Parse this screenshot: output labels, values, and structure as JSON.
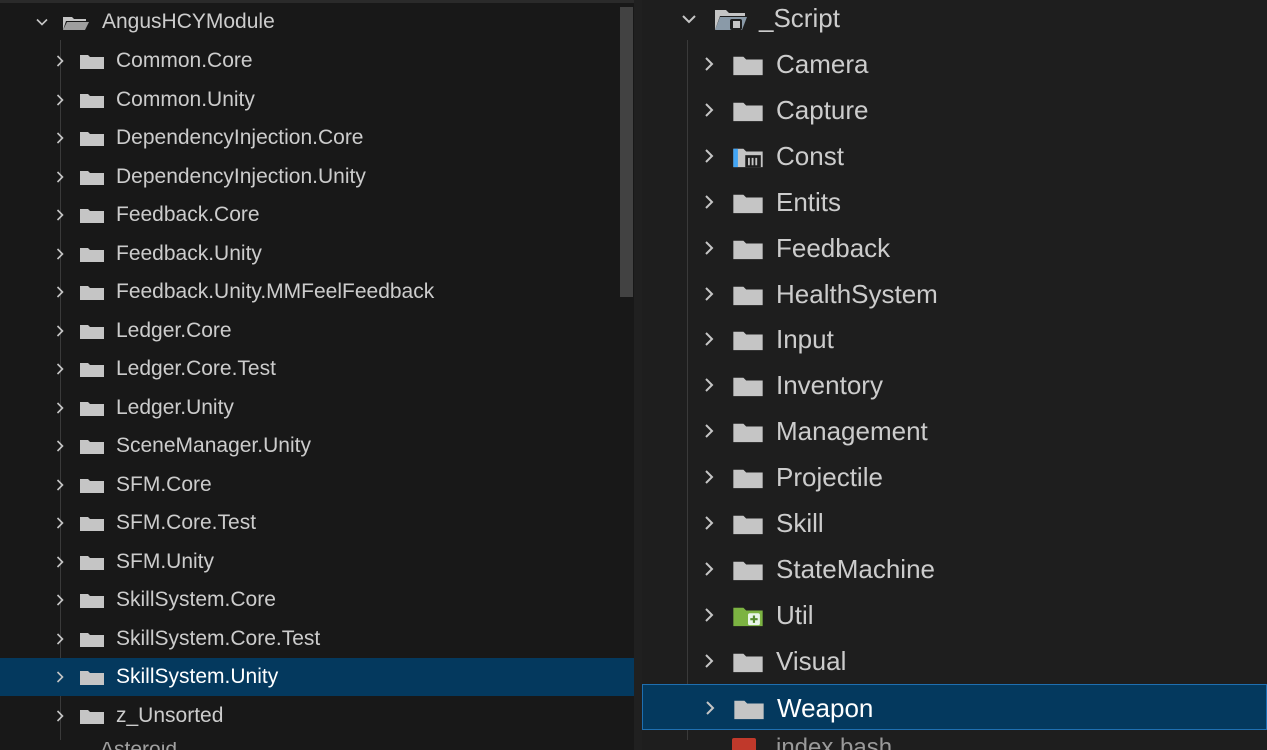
{
  "left_panel": {
    "root": {
      "label": "AngusHCYModule",
      "expanded": true,
      "icon": "folder-open-icon"
    },
    "items": [
      {
        "label": "Common.Core"
      },
      {
        "label": "Common.Unity"
      },
      {
        "label": "DependencyInjection.Core"
      },
      {
        "label": "DependencyInjection.Unity"
      },
      {
        "label": "Feedback.Core"
      },
      {
        "label": "Feedback.Unity"
      },
      {
        "label": "Feedback.Unity.MMFeelFeedback"
      },
      {
        "label": "Ledger.Core"
      },
      {
        "label": "Ledger.Core.Test"
      },
      {
        "label": "Ledger.Unity"
      },
      {
        "label": "SceneManager.Unity"
      },
      {
        "label": "SFM.Core"
      },
      {
        "label": "SFM.Core.Test"
      },
      {
        "label": "SFM.Unity"
      },
      {
        "label": "SkillSystem.Core"
      },
      {
        "label": "SkillSystem.Core.Test"
      },
      {
        "label": "SkillSystem.Unity",
        "selected": true
      },
      {
        "label": "z_Unsorted"
      }
    ],
    "next_root_partial": "Asteroid"
  },
  "right_panel": {
    "root": {
      "label": "_Script",
      "expanded": true,
      "icon": "script-folder-icon"
    },
    "items": [
      {
        "label": "Camera",
        "icon": "folder-icon"
      },
      {
        "label": "Capture",
        "icon": "folder-icon"
      },
      {
        "label": "Const",
        "icon": "const-folder-icon"
      },
      {
        "label": "Entits",
        "icon": "folder-icon"
      },
      {
        "label": "Feedback",
        "icon": "folder-icon"
      },
      {
        "label": "HealthSystem",
        "icon": "folder-icon"
      },
      {
        "label": "Input",
        "icon": "folder-icon"
      },
      {
        "label": "Inventory",
        "icon": "folder-icon"
      },
      {
        "label": "Management",
        "icon": "folder-icon"
      },
      {
        "label": "Projectile",
        "icon": "folder-icon"
      },
      {
        "label": "Skill",
        "icon": "folder-icon"
      },
      {
        "label": "StateMachine",
        "icon": "folder-icon"
      },
      {
        "label": "Util",
        "icon": "util-folder-icon"
      },
      {
        "label": "Visual",
        "icon": "folder-icon"
      },
      {
        "label": "Weapon",
        "icon": "folder-icon",
        "selected": true
      }
    ],
    "next_file_partial": "index.bash"
  },
  "colors": {
    "selection": "#04395e",
    "selection_border": "#1f6fb0",
    "folder": "#c5c5c5",
    "util_folder": "#7cb342",
    "const_folder": "#42a5f5",
    "bash_icon": "#c0392b"
  }
}
